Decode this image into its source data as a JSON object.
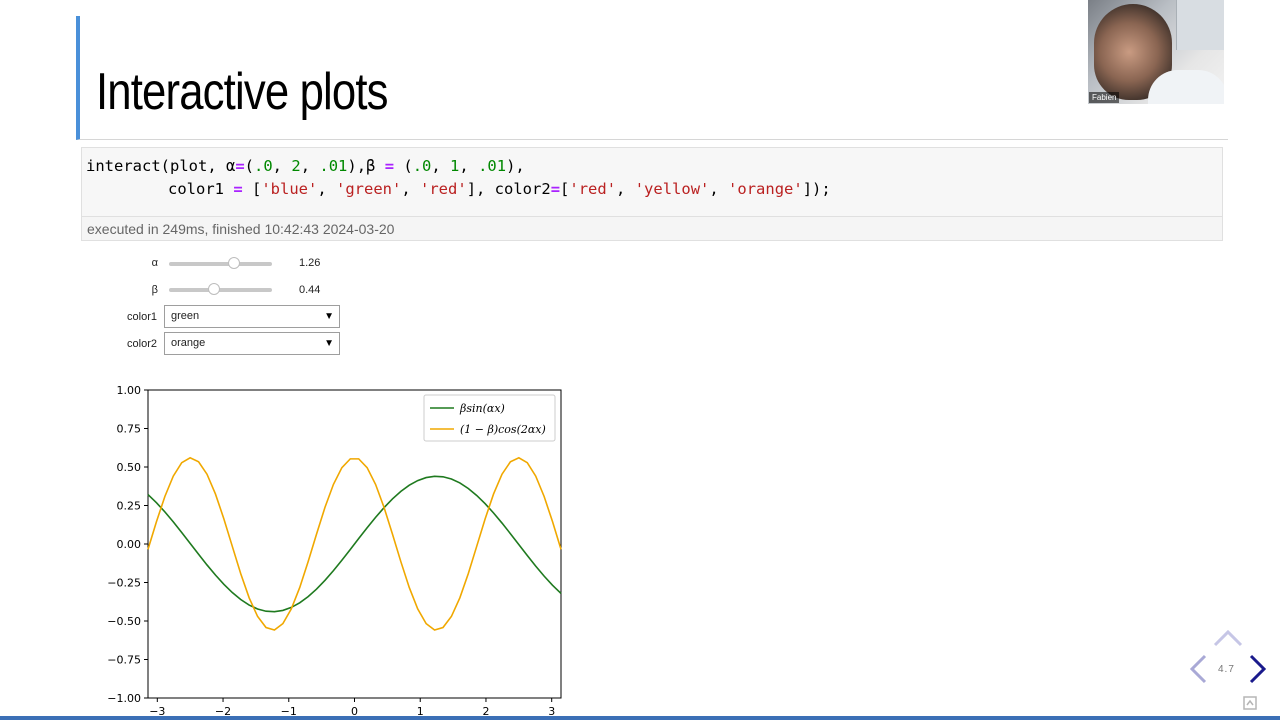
{
  "slide": {
    "title": "Interactive plots",
    "number": "4.7"
  },
  "code_cell": {
    "execution_info": "executed in 249ms, finished 10:42:43 2024-03-20"
  },
  "widgets": {
    "alpha": {
      "label": "α",
      "value": "1.26",
      "min": 0,
      "max": 2,
      "fraction": 0.63
    },
    "beta": {
      "label": "β",
      "value": "0.44",
      "min": 0,
      "max": 1,
      "fraction": 0.44
    },
    "color1": {
      "label": "color1",
      "selected": "green"
    },
    "color2": {
      "label": "color2",
      "selected": "orange"
    }
  },
  "webcam": {
    "name": "Fabien"
  },
  "chart_data": {
    "type": "line",
    "xlim": [
      -3.14159,
      3.14159
    ],
    "ylim": [
      -1.0,
      1.0
    ],
    "xticks": [
      -3,
      -2,
      -1,
      0,
      1,
      2,
      3
    ],
    "xtick_labels": [
      "−3",
      "−2",
      "−1",
      "0",
      "1",
      "2",
      "3"
    ],
    "yticks": [
      1.0,
      0.75,
      0.5,
      0.25,
      0.0,
      -0.25,
      -0.5,
      -0.75,
      -1.0
    ],
    "ytick_labels": [
      "1.00",
      "0.75",
      "0.50",
      "0.25",
      "0.00",
      "−0.25",
      "−0.50",
      "−0.75",
      "−1.00"
    ],
    "legend_position": "top-right",
    "alpha": 1.26,
    "beta": 0.44,
    "series": [
      {
        "name": "βsin(αx)",
        "color": "#1f7a1f",
        "formula": "beta*sin(alpha*x)"
      },
      {
        "name": "(1 − β)cos(2αx)",
        "color": "#f0a800",
        "formula": "(1-beta)*cos(2*alpha*x)"
      }
    ]
  },
  "colors": {
    "title_accent": "#4a90d9",
    "nav_arrow_active": "#1a1a8c",
    "nav_arrow_inactive": "#a9a9d6"
  }
}
